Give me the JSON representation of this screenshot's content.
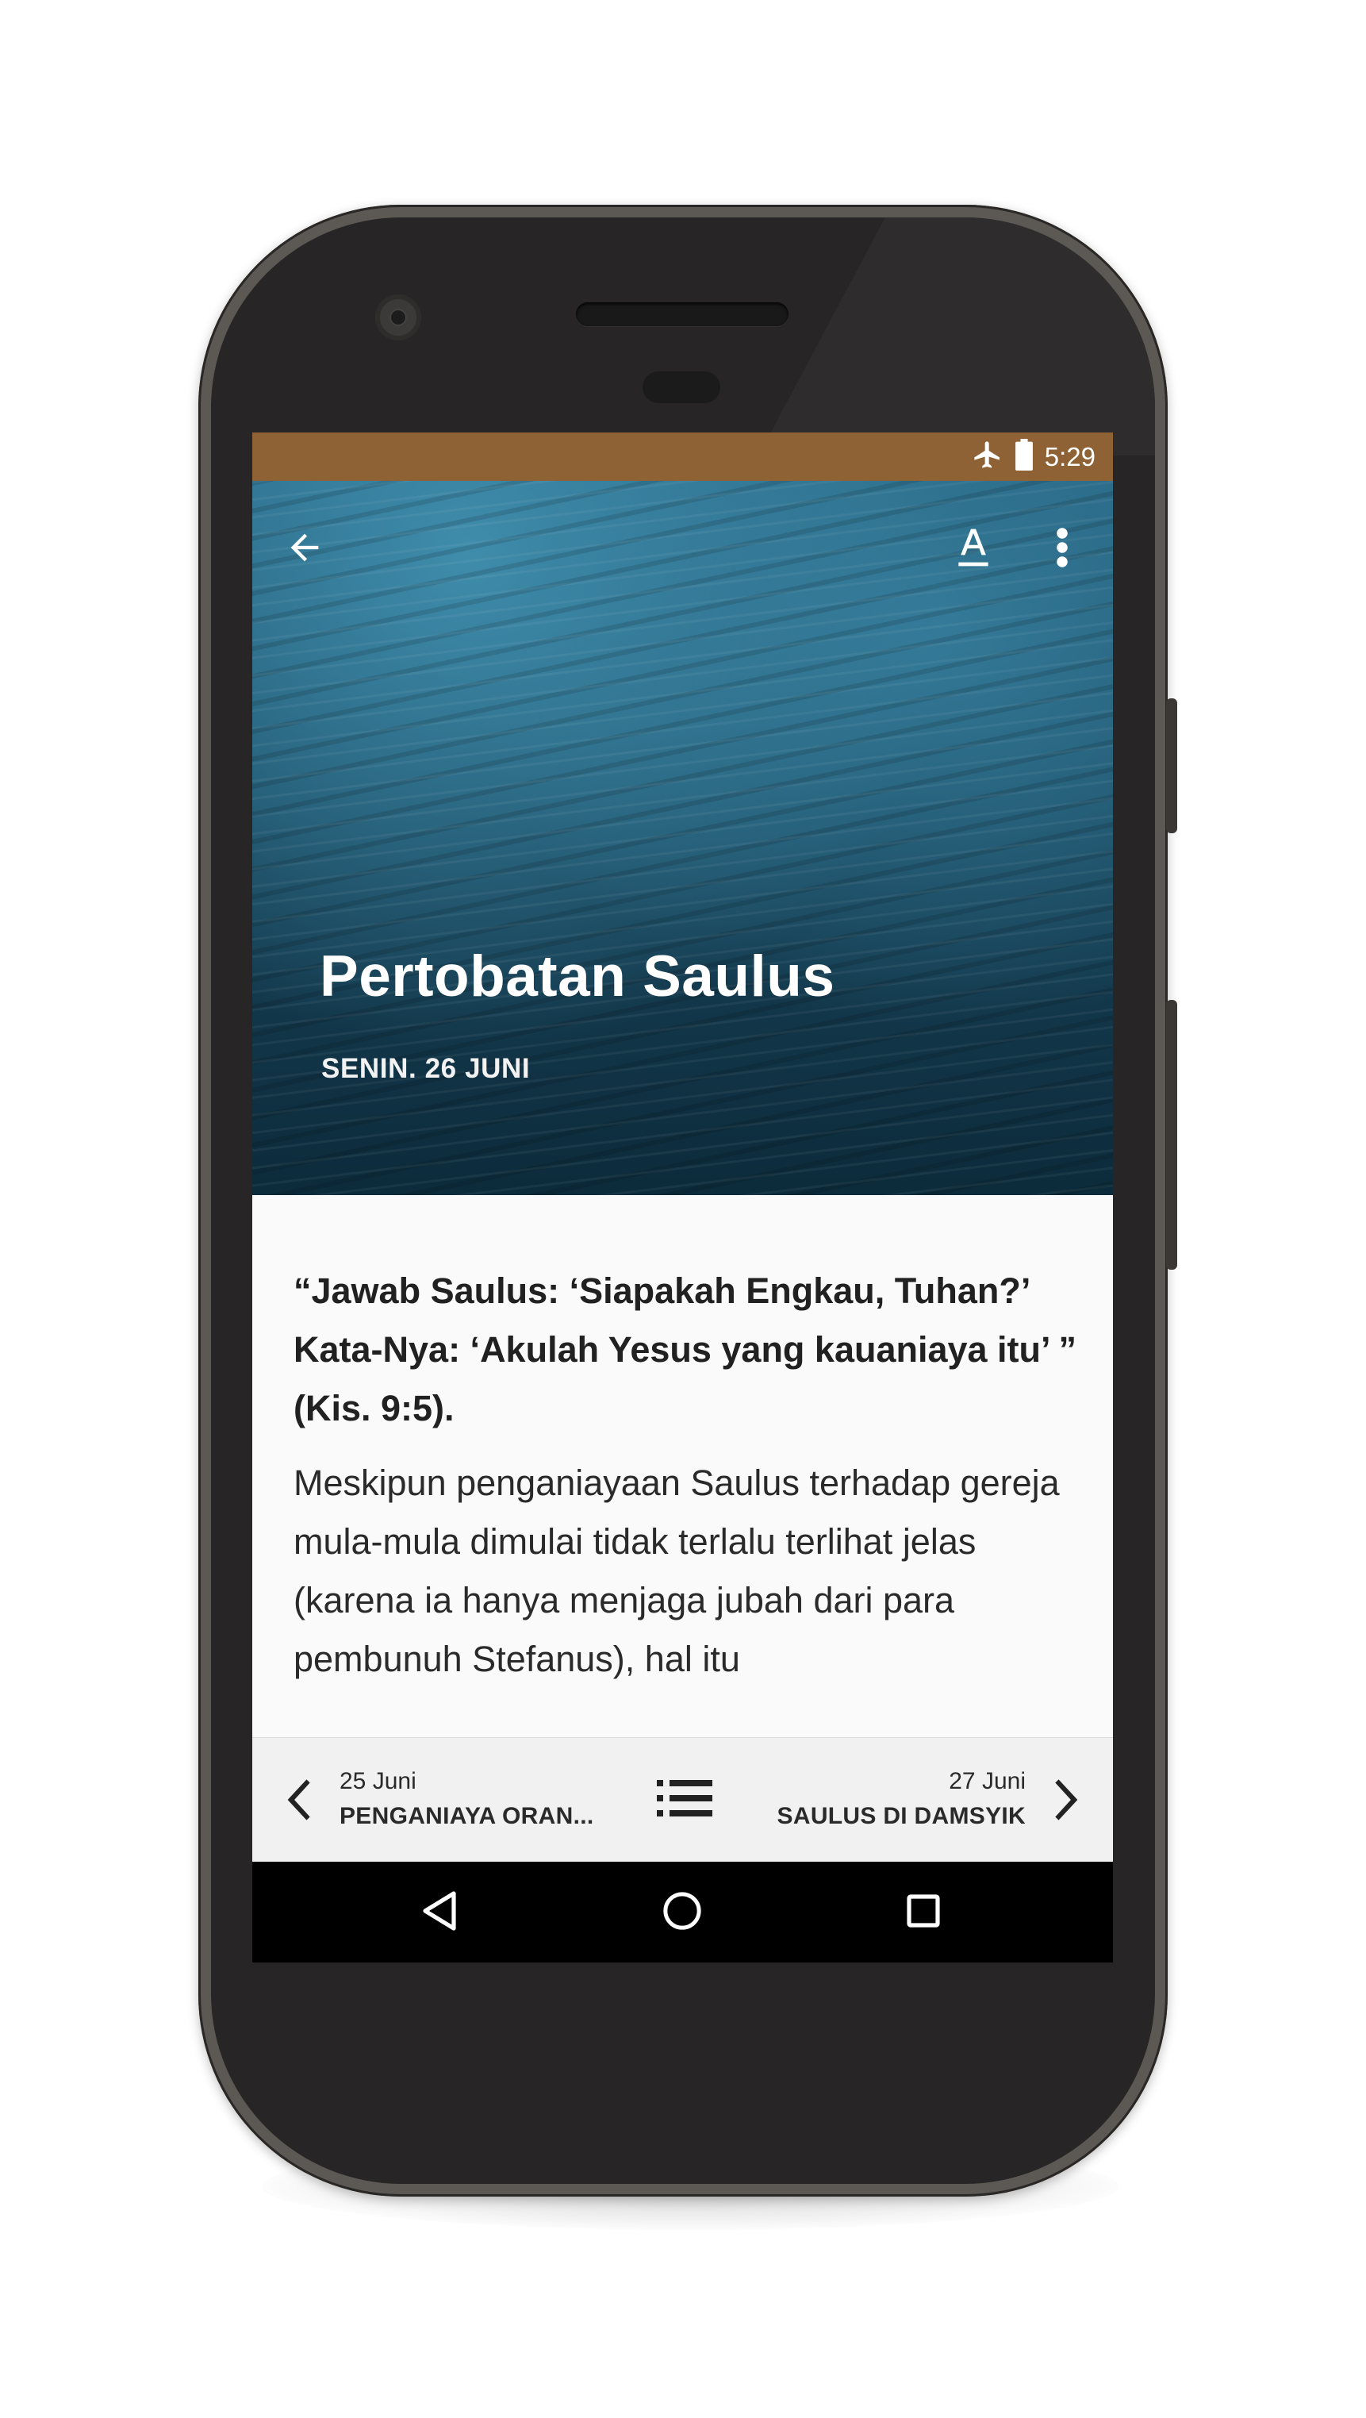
{
  "status_bar": {
    "time": "5:29",
    "icons": [
      "airplane-icon",
      "battery-icon"
    ],
    "color": "#8e6234"
  },
  "toolbar": {
    "back_icon": "arrow-left-icon",
    "text_size_icon": "text-format-icon",
    "menu_icon": "more-vert-icon"
  },
  "article": {
    "title": "Pertobatan Saulus",
    "date": "SENIN. 26 JUNI",
    "quote": "“Jawab Saulus: ‘Siapakah Engkau, Tuhan?’ Kata-Nya: ‘Akulah Yesus yang kauaniaya itu’ ” (Kis. 9:5).",
    "paragraph": "Meskipun penganiayaan Saulus terhadap gereja mula-mula dimulai tidak terlalu terlihat jelas (karena ia hanya menjaga jubah dari para pembunuh Stefanus), hal itu"
  },
  "bottom_nav": {
    "prev": {
      "date": "25 Juni",
      "title": "PENGANIAYA ORAN..."
    },
    "list_icon": "list-icon",
    "next": {
      "date": "27 Juni",
      "title": "SAULUS DI DAMSYIK"
    }
  },
  "system_nav": {
    "back_icon": "triangle-back-icon",
    "home_icon": "circle-home-icon",
    "recents_icon": "square-recents-icon"
  }
}
